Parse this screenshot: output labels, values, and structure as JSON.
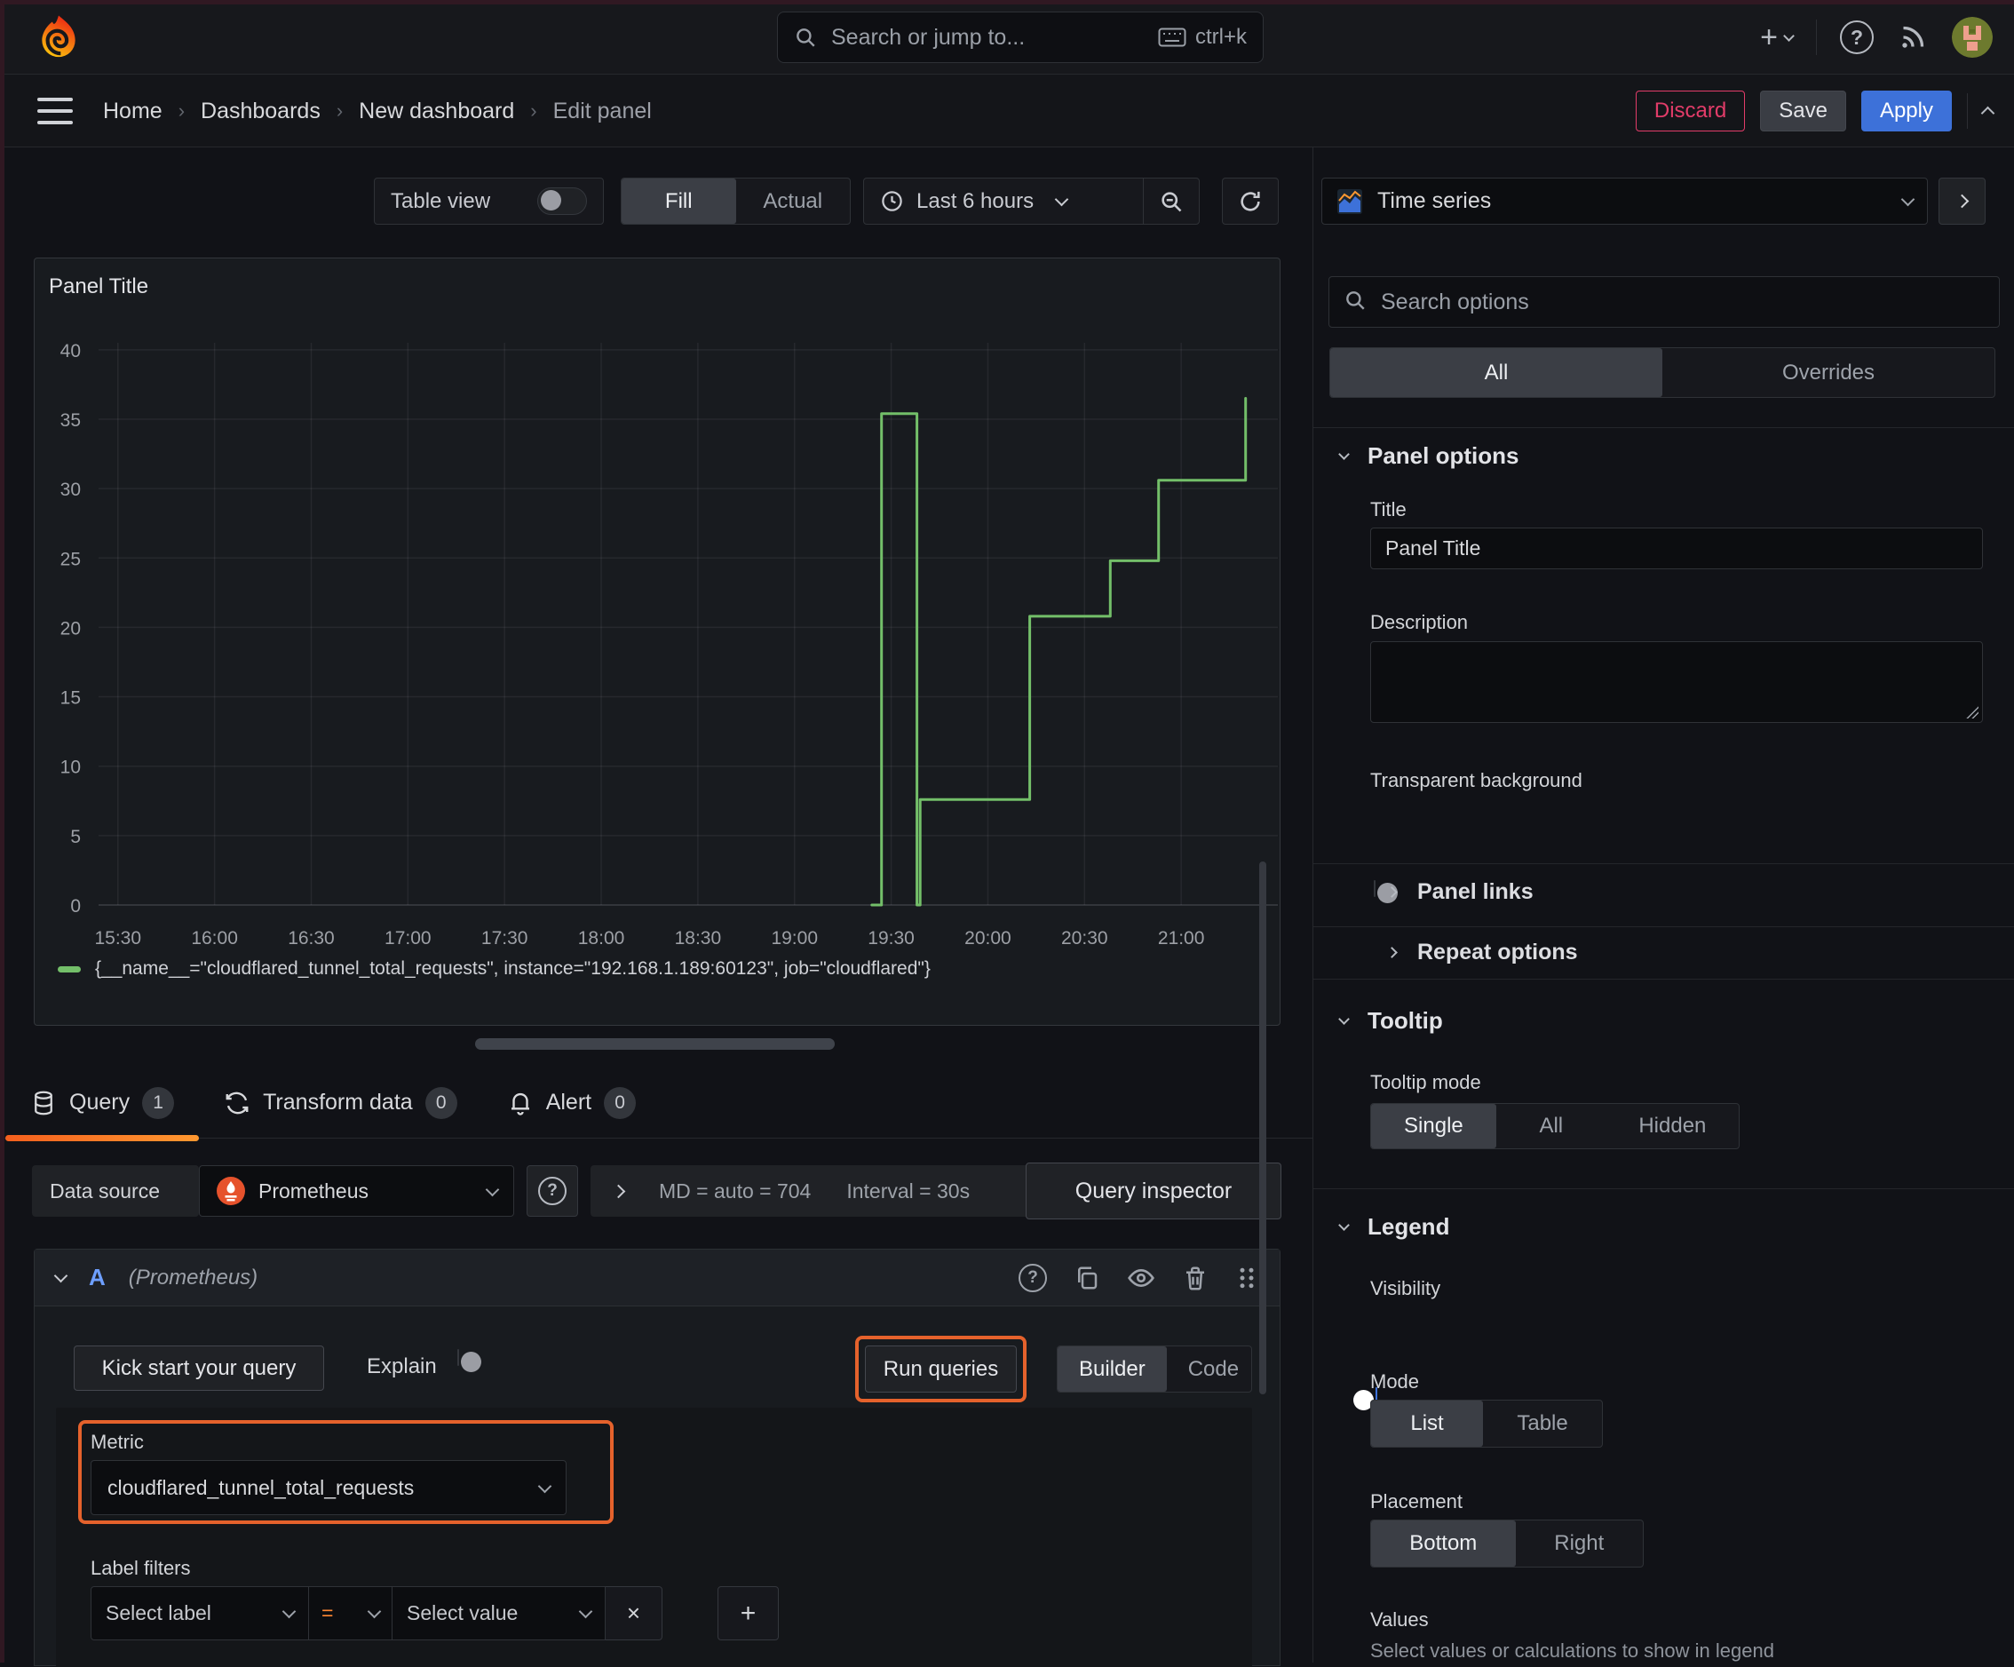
{
  "topbar": {
    "search_placeholder": "Search or jump to...",
    "shortcut": "ctrl+k"
  },
  "breadcrumb": {
    "items": [
      {
        "label": "Home"
      },
      {
        "label": "Dashboards"
      },
      {
        "label": "New dashboard"
      },
      {
        "label": "Edit panel"
      }
    ]
  },
  "actions": {
    "discard": "Discard",
    "save": "Save",
    "apply": "Apply"
  },
  "toolbar": {
    "table_view_label": "Table view",
    "fill_label": "Fill",
    "actual_label": "Actual",
    "time_range": "Last 6 hours"
  },
  "panel": {
    "title": "Panel Title"
  },
  "chart_data": {
    "type": "line",
    "render": "stepped",
    "title": "Panel Title",
    "x_ticks": [
      "15:30",
      "16:00",
      "16:30",
      "17:00",
      "17:30",
      "18:00",
      "18:30",
      "19:00",
      "19:30",
      "20:00",
      "20:30",
      "21:00"
    ],
    "x_tick_minutes": [
      0,
      30,
      60,
      90,
      120,
      150,
      180,
      210,
      240,
      270,
      300,
      330
    ],
    "xlim_minutes": [
      -6,
      360
    ],
    "y_ticks": [
      0,
      5,
      10,
      15,
      20,
      25,
      30,
      35,
      40
    ],
    "ylim": [
      0,
      40.5
    ],
    "grid": true,
    "legend_position": "bottom",
    "series": [
      {
        "name": "{__name__=\"cloudflared_tunnel_total_requests\", instance=\"192.168.1.189:60123\", job=\"cloudflared\"}",
        "color": "#73bf69",
        "x_unit": "minutes_after_15:30",
        "points": [
          [
            234,
            0
          ],
          [
            237,
            0
          ],
          [
            237,
            35.4
          ],
          [
            248,
            35.4
          ],
          [
            248,
            0
          ],
          [
            249,
            0
          ],
          [
            249,
            7.6
          ],
          [
            283,
            7.6
          ],
          [
            283,
            20.8
          ],
          [
            308,
            20.8
          ],
          [
            308,
            24.8
          ],
          [
            323,
            24.8
          ],
          [
            323,
            30.6
          ],
          [
            350,
            30.6
          ],
          [
            350,
            36.5
          ]
        ]
      }
    ]
  },
  "tabs": {
    "query": "Query",
    "query_count": "1",
    "transform": "Transform data",
    "transform_count": "0",
    "alert": "Alert",
    "alert_count": "0"
  },
  "datasource_row": {
    "label": "Data source",
    "value": "Prometheus",
    "stats": "MD = auto = 704",
    "interval": "Interval = 30s",
    "inspector": "Query inspector"
  },
  "query_row": {
    "ref_id": "A",
    "datasource_hint": "(Prometheus)"
  },
  "query_actions": {
    "kickstart": "Kick start your query",
    "explain": "Explain",
    "run": "Run queries",
    "builder": "Builder",
    "code": "Code"
  },
  "metric_section": {
    "metric_label": "Metric",
    "metric_value": "cloudflared_tunnel_total_requests",
    "label_filters_label": "Label filters",
    "select_label_placeholder": "Select label",
    "operator": "=",
    "select_value_placeholder": "Select value"
  },
  "sidebar": {
    "visualization": "Time series",
    "search_placeholder": "Search options",
    "tabs": {
      "all": "All",
      "overrides": "Overrides"
    },
    "panel_options": {
      "title": "Panel options",
      "title_label": "Title",
      "title_value": "Panel Title",
      "description_label": "Description",
      "transparent_label": "Transparent background"
    },
    "collapsed": {
      "panel_links": "Panel links",
      "repeat_options": "Repeat options"
    },
    "tooltip": {
      "title": "Tooltip",
      "mode_label": "Tooltip mode",
      "options": [
        "Single",
        "All",
        "Hidden"
      ],
      "selected": "Single"
    },
    "legend": {
      "title": "Legend",
      "visibility_label": "Visibility",
      "mode_label": "Mode",
      "mode_options": [
        "List",
        "Table"
      ],
      "mode_selected": "List",
      "placement_label": "Placement",
      "placement_options": [
        "Bottom",
        "Right"
      ],
      "placement_selected": "Bottom",
      "values_label": "Values",
      "values_hint": "Select values or calculations to show in legend"
    }
  },
  "colors": {
    "series_green": "#73bf69",
    "highlight_orange": "#e5622c",
    "accent_blue": "#3d71d9",
    "danger_pink": "#e23c69",
    "tab_underline": "#ff8833"
  }
}
